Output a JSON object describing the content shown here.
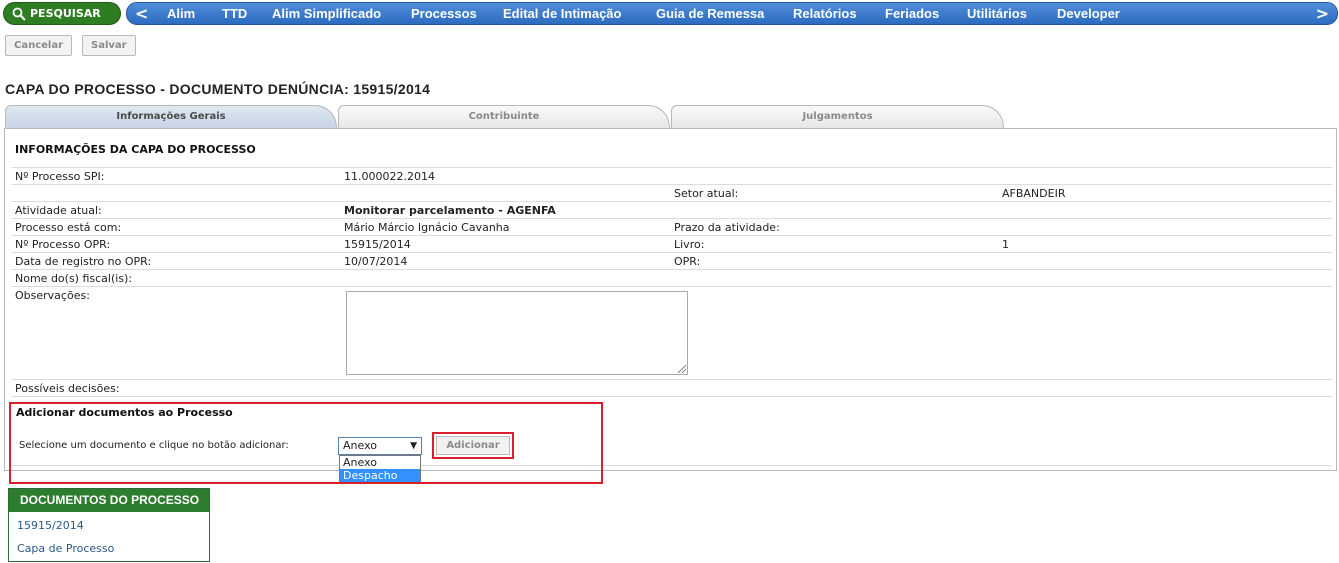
{
  "topbar": {
    "search_label": "PESQUISAR",
    "nav_left": "<",
    "nav_right": ">",
    "nav_items": [
      "Alim",
      "TTD",
      "Alim Simplificado",
      "Processos",
      "Edital de Intimação",
      "Guia de Remessa",
      "Relatórios",
      "Feriados",
      "Utilitários",
      "Developer"
    ]
  },
  "actions": {
    "cancel": "Cancelar",
    "save": "Salvar"
  },
  "page_title": "CAPA DO PROCESSO - DOCUMENTO DENÚNCIA: 15915/2014",
  "tabs": [
    "Informações Gerais",
    "Contribuinte",
    "Julgamentos"
  ],
  "info": {
    "section_title": "INFORMAÇÕES DA CAPA DO PROCESSO",
    "processo_spi_label": "Nº Processo SPI:",
    "processo_spi_value": "11.000022.2014",
    "setor_label": "Setor atual:",
    "setor_value": "AFBANDEIR",
    "atividade_label": "Atividade atual:",
    "atividade_value": "Monitorar parcelamento - AGENFA",
    "com_label": "Processo está com:",
    "com_value": "Mário Márcio Ignácio Cavanha",
    "prazo_label": "Prazo da atividade:",
    "opr_label": "Nº Processo OPR:",
    "opr_value": "15915/2014",
    "livro_label": "Livro:",
    "livro_value": "1",
    "data_label": "Data de registro no OPR:",
    "data_value": "10/07/2014",
    "opr2_label": "OPR:",
    "fiscal_label": "Nome do(s) fiscal(is):",
    "obs_label": "Observações:",
    "decisoes_label": "Possíveis decisões:"
  },
  "add_docs": {
    "title": "Adicionar documentos ao Processo",
    "instruction": "Selecione um documento e clique no botão adicionar:",
    "selected": "Anexo",
    "options": [
      "Anexo",
      "Despacho"
    ],
    "button": "Adicionar"
  },
  "documents": {
    "header": "DOCUMENTOS DO PROCESSO",
    "items": [
      "15915/2014",
      "Capa de Processo"
    ]
  },
  "colors": {
    "nav_blue": "#2d6bc0",
    "green": "#2e7d2f",
    "highlight_red": "#d9202c"
  }
}
